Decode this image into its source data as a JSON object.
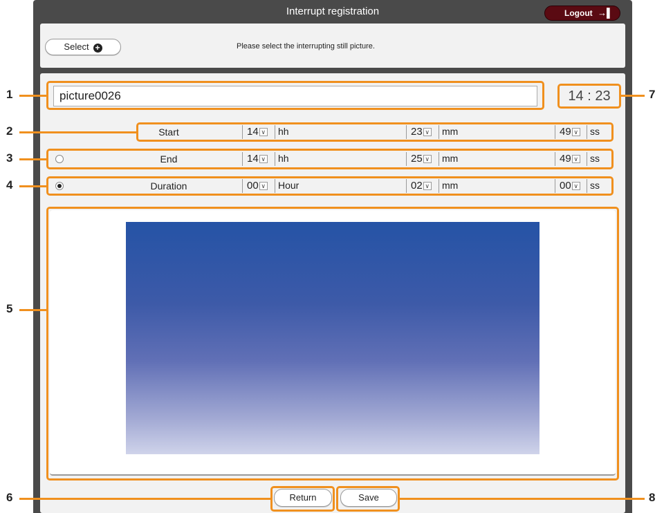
{
  "header": {
    "title": "Interrupt registration",
    "logout_label": "Logout",
    "logout_icon": "logout-icon"
  },
  "select_bar": {
    "select_label": "Select",
    "select_icon": "plus-circle-icon",
    "instruction": "Please select the interrupting still picture."
  },
  "picture_name": "picture0026",
  "clock": "14 : 23",
  "rows": {
    "start": {
      "label": "Start",
      "hh": "14",
      "hh_unit": "hh",
      "mm": "23",
      "mm_unit": "mm",
      "ss": "49",
      "ss_unit": "ss"
    },
    "end": {
      "label": "End",
      "hh": "14",
      "hh_unit": "hh",
      "mm": "25",
      "mm_unit": "mm",
      "ss": "49",
      "ss_unit": "ss"
    },
    "duration": {
      "label": "Duration",
      "hh": "00",
      "hh_unit": "Hour",
      "mm": "02",
      "mm_unit": "mm",
      "ss": "00",
      "ss_unit": "ss"
    }
  },
  "mode_selected": "duration",
  "footer": {
    "return_label": "Return",
    "save_label": "Save"
  },
  "callouts": [
    "1",
    "2",
    "3",
    "4",
    "5",
    "6",
    "7",
    "8"
  ],
  "colors": {
    "callout_orange": "#f0901e",
    "frame_dark": "#4a4a4a",
    "logout_red": "#5a0a12"
  }
}
